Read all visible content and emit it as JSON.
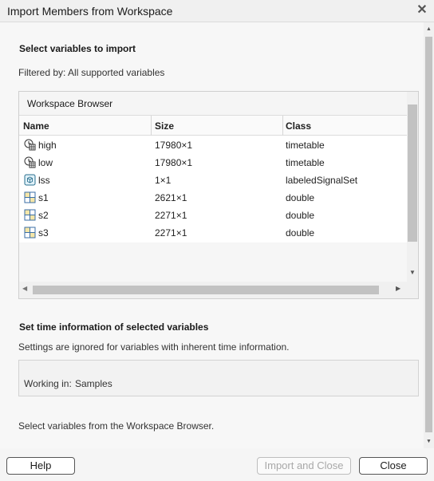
{
  "window": {
    "title": "Import Members from Workspace",
    "close_glyph": "✕"
  },
  "select_heading": "Select variables to import",
  "filter_text": "Filtered by: All supported variables",
  "browser": {
    "title": "Workspace Browser",
    "columns": [
      "Name",
      "Size",
      "Class"
    ],
    "rows": [
      {
        "name": "high",
        "size": "17980×1",
        "class": "timetable",
        "icon": "timetable-icon"
      },
      {
        "name": "low",
        "size": "17980×1",
        "class": "timetable",
        "icon": "timetable-icon"
      },
      {
        "name": "lss",
        "size": "1×1",
        "class": "labeledSignalSet",
        "icon": "object-icon"
      },
      {
        "name": "s1",
        "size": "2621×1",
        "class": "double",
        "icon": "matrix-icon"
      },
      {
        "name": "s2",
        "size": "2271×1",
        "class": "double",
        "icon": "matrix-icon"
      },
      {
        "name": "s3",
        "size": "2271×1",
        "class": "double",
        "icon": "matrix-icon"
      }
    ]
  },
  "time": {
    "heading": "Set time information of selected variables",
    "note": "Settings are ignored for variables with inherent time information.",
    "working_label": "Working in:",
    "working_value": "Samples"
  },
  "status_text": "Select variables from the Workspace Browser.",
  "buttons": {
    "help": "Help",
    "import_close": "Import and Close",
    "close": "Close"
  },
  "colors": {
    "accent": "#0072bd",
    "border": "#555555"
  }
}
